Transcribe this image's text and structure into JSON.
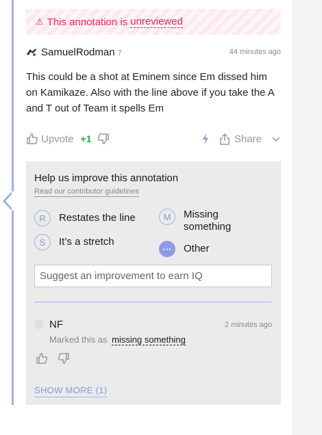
{
  "banner": {
    "prefix": "This annotation is",
    "link": "unreviewed",
    "icon": "warning-triangle-icon",
    "color": "#e6285a"
  },
  "annotation": {
    "author": "SamuelRodman",
    "author_iq": "7",
    "timestamp": "44 minutes ago",
    "body": "This could be a shot at Eminem since Em dissed him on Kamikaze. Also with the line above if you take the A and T out of Team it spells Em"
  },
  "actions": {
    "upvote_label": "Upvote",
    "vote_count": "+1",
    "share_label": "Share"
  },
  "improve": {
    "title": "Help us improve this annotation",
    "guidelines_link": "Read our contributor guidelines",
    "options": [
      {
        "letter": "R",
        "label": "Restates the line"
      },
      {
        "letter": "S",
        "label": "It’s a stretch"
      },
      {
        "letter": "M",
        "label": "Missing something"
      },
      {
        "letter": "···",
        "label": "Other"
      }
    ],
    "input_placeholder": "Suggest an improvement to earn IQ",
    "accent_color": "#8d9be6"
  },
  "comment": {
    "name": "NF",
    "timestamp": "2 minutes ago",
    "marked_prefix": "Marked this as",
    "marked_tag": "missing something"
  },
  "show_more": "SHOW MORE (1)"
}
